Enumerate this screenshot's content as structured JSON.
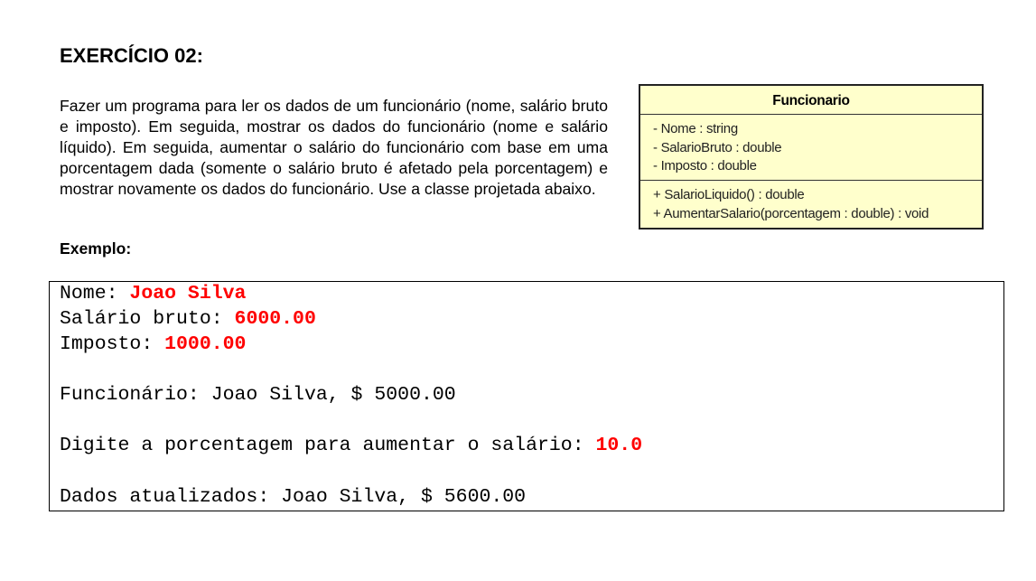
{
  "title": "EXERCÍCIO 02:",
  "description": "Fazer um programa para ler os dados de um funcionário (nome, salário bruto e imposto). Em seguida, mostrar os dados do funcionário (nome e salário líquido). Em seguida, aumentar o salário do funcionário com base em uma porcentagem dada (somente o salário bruto é afetado pela porcentagem) e mostrar novamente os dados do funcionário. Use a classe projetada abaixo.",
  "example_label": "Exemplo:",
  "uml": {
    "class_name": "Funcionario",
    "attributes": [
      "- Nome : string",
      "- SalarioBruto : double",
      "- Imposto : double"
    ],
    "operations": [
      "+ SalarioLiquido() : double",
      "+ AumentarSalario(porcentagem : double) : void"
    ],
    "fill_color": "#ffffcc"
  },
  "console": {
    "input_color": "#ff0000",
    "lines": [
      {
        "prompt": "Nome: ",
        "input": "Joao Silva"
      },
      {
        "prompt": "Salário bruto: ",
        "input": "6000.00"
      },
      {
        "prompt": "Imposto: ",
        "input": "1000.00"
      },
      {
        "prompt": "Funcionário: Joao Silva, $ 5000.00",
        "input": ""
      },
      {
        "prompt": "Digite a porcentagem para aumentar o salário: ",
        "input": "10.0"
      },
      {
        "prompt": "Dados atualizados: Joao Silva, $ 5600.00",
        "input": ""
      }
    ]
  }
}
